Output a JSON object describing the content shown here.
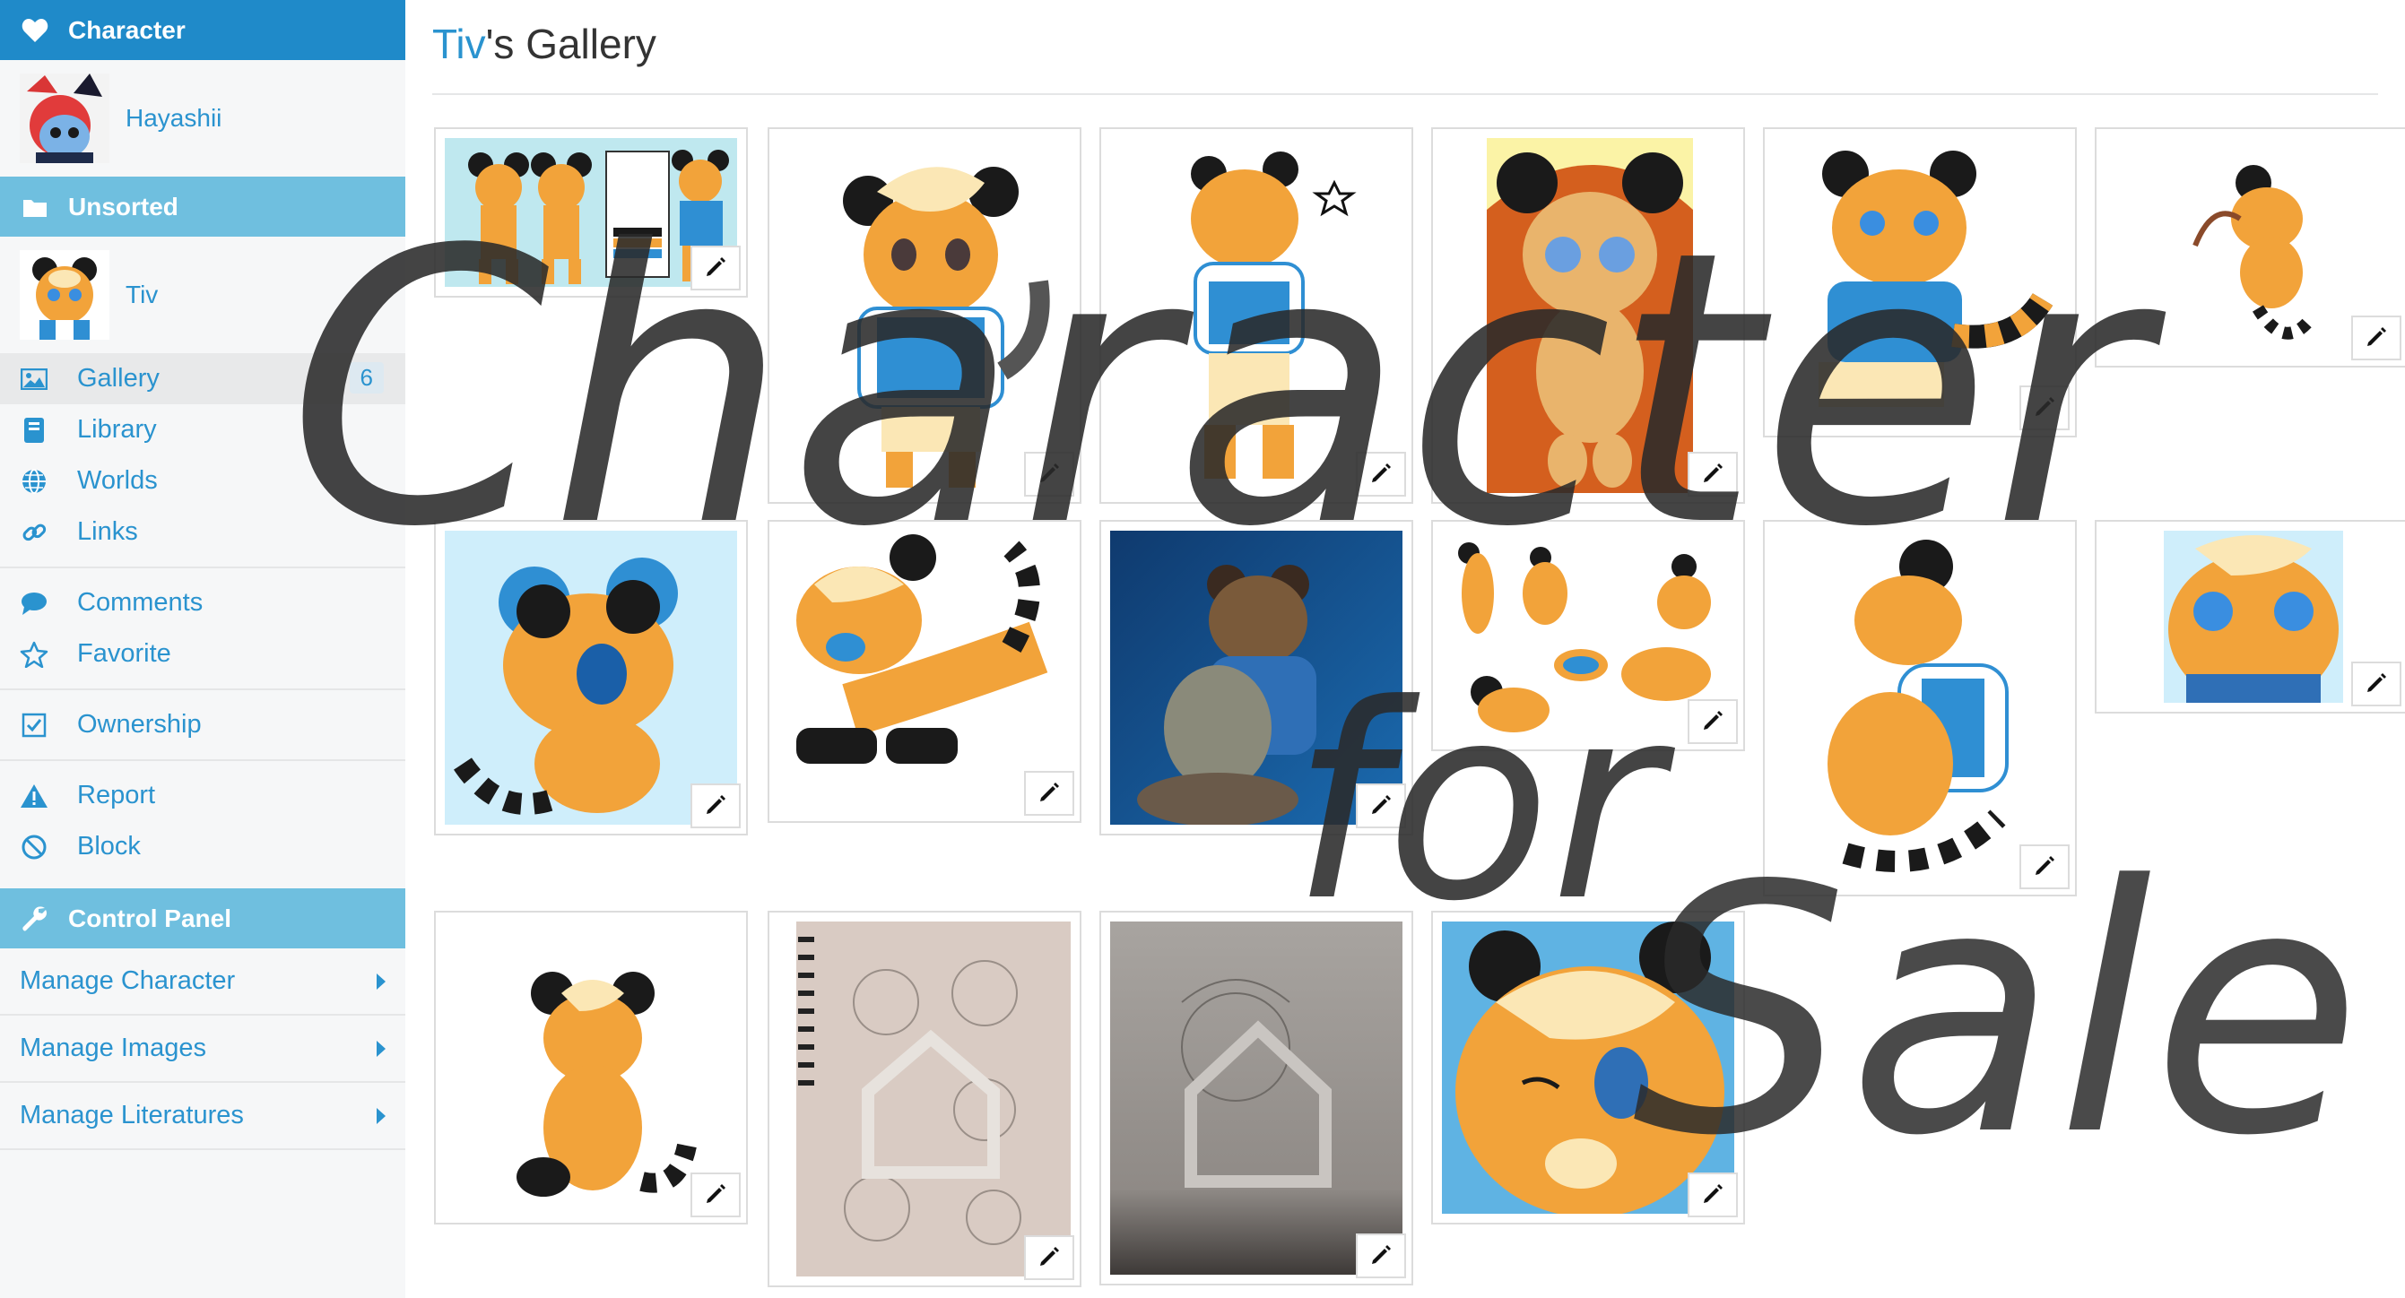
{
  "sidebar": {
    "character_header": "Character",
    "owner_name": "Hayashii",
    "folder_header": "Unsorted",
    "character_name": "Tiv",
    "nav": {
      "gallery": "Gallery",
      "gallery_count": "6",
      "library": "Library",
      "worlds": "Worlds",
      "links": "Links",
      "comments": "Comments",
      "favorite": "Favorite",
      "ownership": "Ownership",
      "report": "Report",
      "block": "Block"
    },
    "control_panel_header": "Control Panel",
    "control_panel_items": [
      "Manage Character",
      "Manage Images",
      "Manage Literatures"
    ]
  },
  "main": {
    "title_owner": "Tiv",
    "title_suffix": "'s Gallery"
  },
  "overlay_text": {
    "line1": "Character",
    "line2": "for",
    "line3": "Sale"
  },
  "colors": {
    "accent": "#1f8ac9",
    "accent_light": "#6fbfdf",
    "link": "#2a93cf"
  },
  "icons": {
    "character_header": "heart-icon",
    "folder_header": "folder-icon",
    "gallery": "image-icon",
    "library": "book-icon",
    "worlds": "globe-icon",
    "links": "link-icon",
    "comments": "comment-icon",
    "favorite": "star-icon",
    "ownership": "checkbox-icon",
    "report": "warning-icon",
    "block": "ban-icon",
    "control_panel": "wrench-icon",
    "edit": "pencil-icon"
  }
}
